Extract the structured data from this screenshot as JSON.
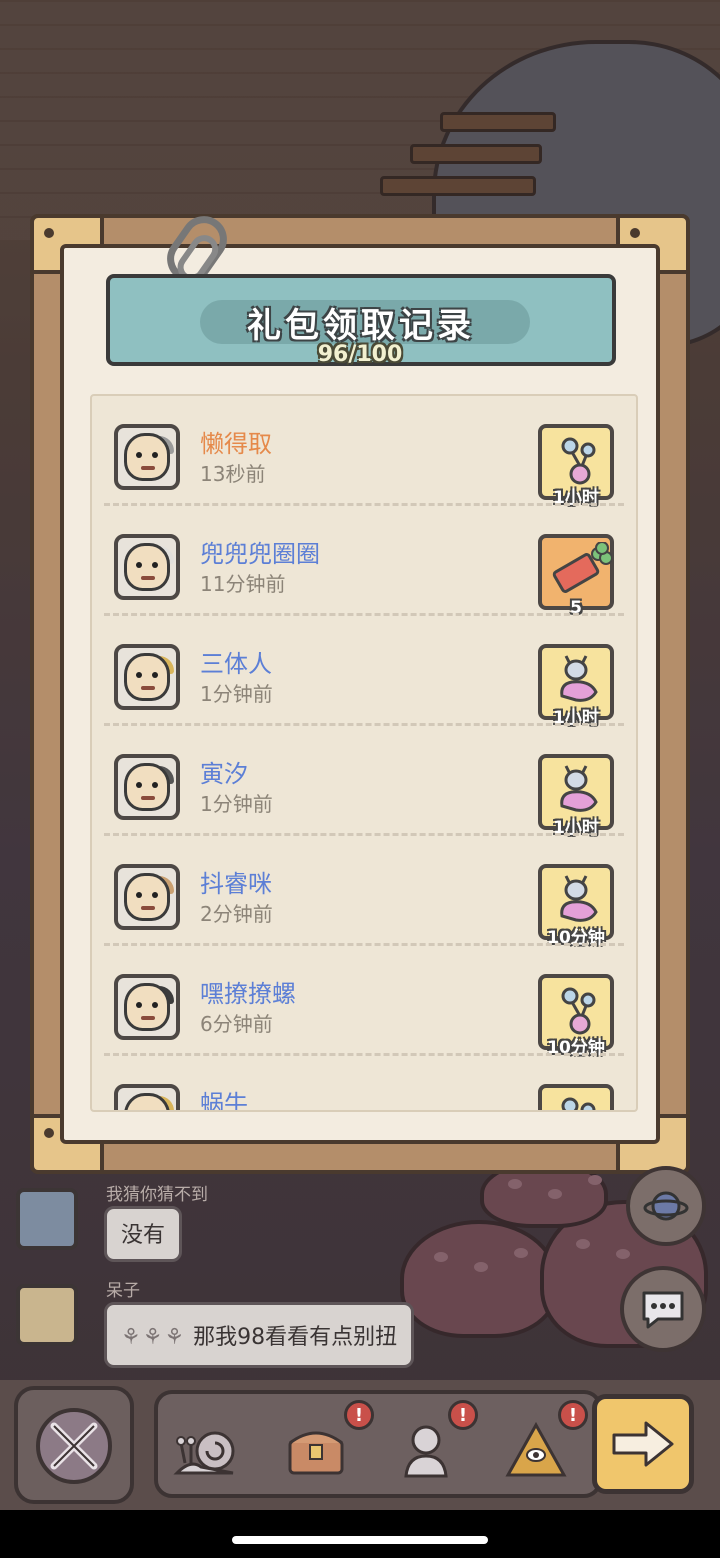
{
  "panel": {
    "title": "礼包领取记录",
    "count": "96/100"
  },
  "records": [
    {
      "name": "懒得取",
      "time": "13秒前",
      "name_color": "#e5894a",
      "gift_icon": "potion-icon",
      "gift_label": "1小时",
      "gift_bg": "yellow"
    },
    {
      "name": "兜兜兜圈圈",
      "time": "11分钟前",
      "name_color": "#5c7fd6",
      "gift_icon": "ticket-clover-icon",
      "gift_label": "5",
      "gift_bg": "orange"
    },
    {
      "name": "三体人",
      "time": "1分钟前",
      "name_color": "#5c7fd6",
      "gift_icon": "snail-potion-icon",
      "gift_label": "1小时",
      "gift_bg": "yellow"
    },
    {
      "name": "寅汐",
      "time": "1分钟前",
      "name_color": "#5c7fd6",
      "gift_icon": "snail-potion-icon",
      "gift_label": "1小时",
      "gift_bg": "yellow"
    },
    {
      "name": "抖睿咪",
      "time": "2分钟前",
      "name_color": "#5c7fd6",
      "gift_icon": "snail-potion-icon",
      "gift_label": "10分钟",
      "gift_bg": "yellow"
    },
    {
      "name": "嘿撩撩螺",
      "time": "6分钟前",
      "name_color": "#5c7fd6",
      "gift_icon": "potion-icon",
      "gift_label": "10分钟",
      "gift_bg": "yellow"
    },
    {
      "name": "蜗牛",
      "time": "",
      "name_color": "#5c7fd6",
      "gift_icon": "potion-icon",
      "gift_label": "",
      "gift_bg": "yellow"
    }
  ],
  "chat": [
    {
      "user": "我猜你猜不到",
      "message": "没有"
    },
    {
      "user": "呆子",
      "message": "那我98看看有点别扭"
    }
  ],
  "nav": {
    "badges": [
      "!",
      "!",
      "!"
    ]
  }
}
